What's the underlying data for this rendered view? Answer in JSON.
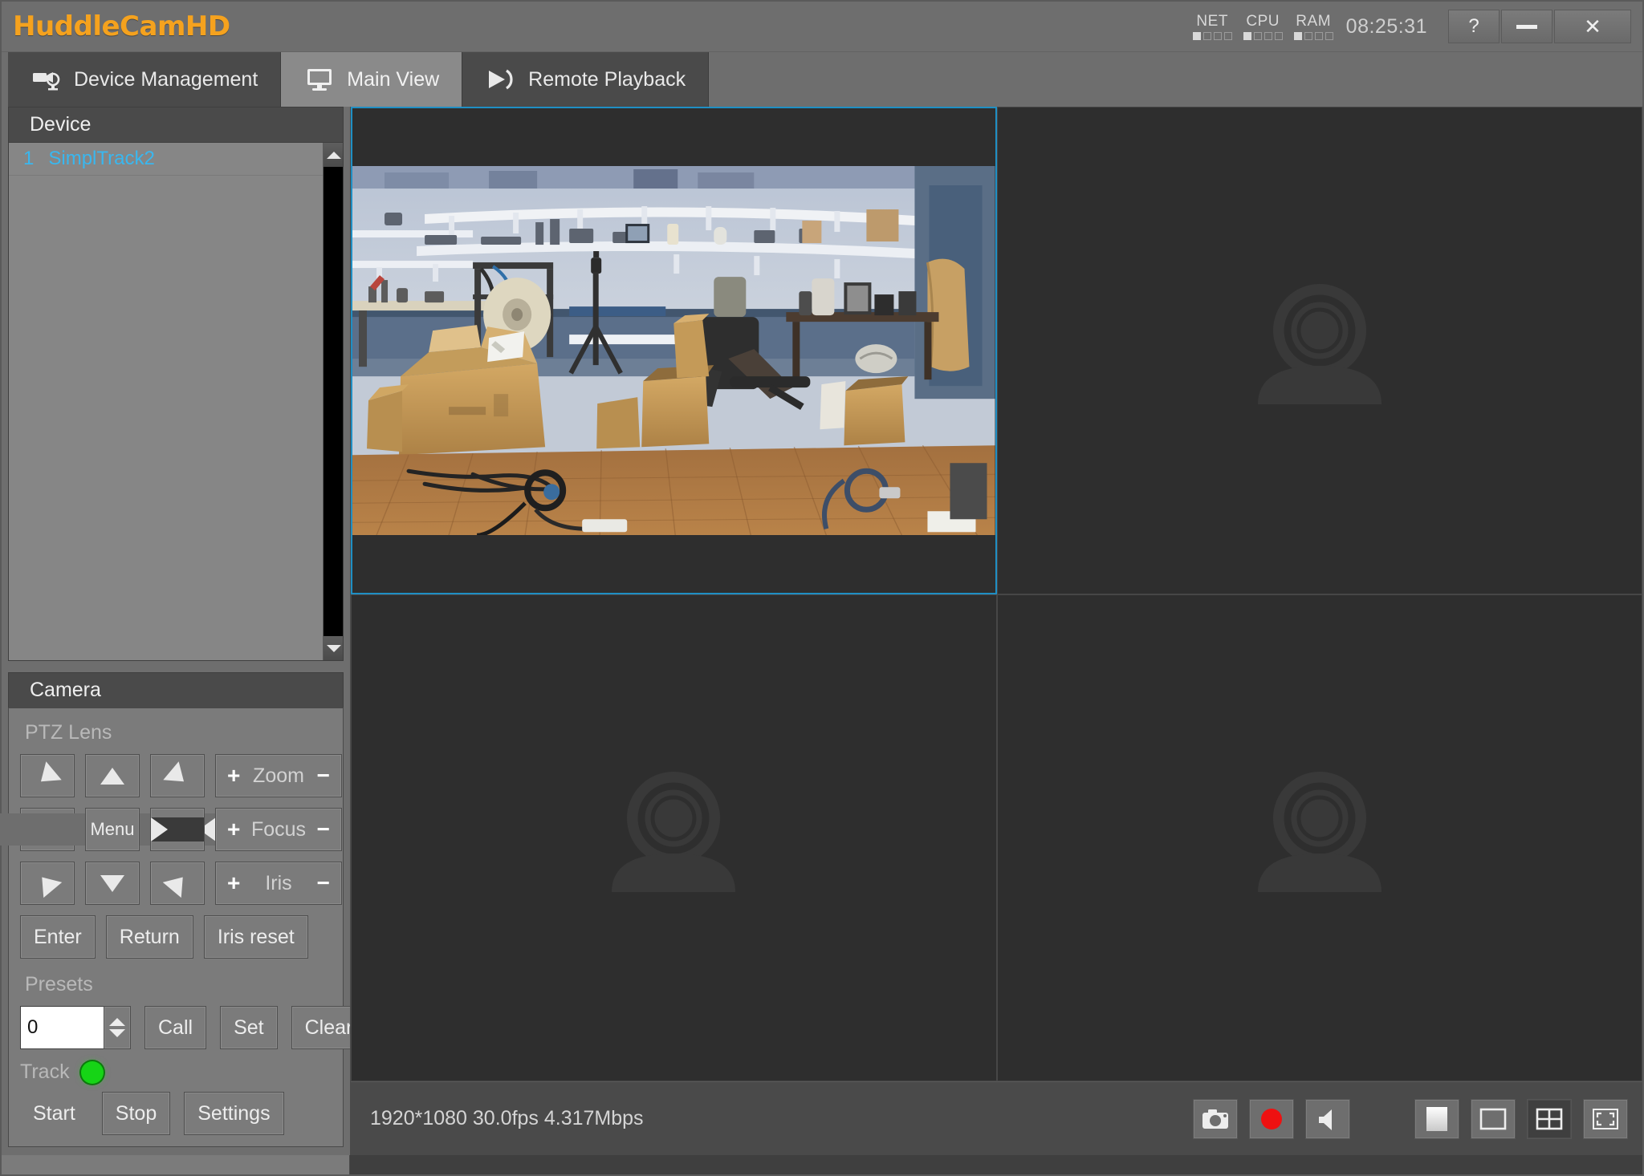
{
  "app": {
    "brand": "HuddleCamHD",
    "clock": "08:25:31"
  },
  "titlebar": {
    "meters": [
      {
        "label": "NET",
        "filled": 1,
        "total": 4
      },
      {
        "label": "CPU",
        "filled": 1,
        "total": 4
      },
      {
        "label": "RAM",
        "filled": 1,
        "total": 4
      }
    ],
    "window_buttons": [
      {
        "name": "help-button",
        "label": "?"
      },
      {
        "name": "minimize-button",
        "label": ""
      },
      {
        "name": "close-button",
        "label": "✕"
      }
    ]
  },
  "tabs": [
    {
      "label": "Device Management",
      "icon": "video-camera-icon",
      "active": false
    },
    {
      "label": "Main View",
      "icon": "monitor-icon",
      "active": true
    },
    {
      "label": "Remote Playback",
      "icon": "play-icon",
      "active": false
    }
  ],
  "device_panel": {
    "title": "Device",
    "rows": [
      {
        "index": "1",
        "name": "SimplTrack2"
      }
    ]
  },
  "camera_panel": {
    "title": "Camera",
    "ptz_label": "PTZ Lens",
    "dpad": [
      {
        "name": "pan-up-left-button",
        "dir": "nw"
      },
      {
        "name": "pan-up-button",
        "dir": "up"
      },
      {
        "name": "pan-up-right-button",
        "dir": "ne"
      },
      {
        "name": "pan-left-button",
        "dir": "left"
      },
      {
        "name": "menu-button",
        "dir": "menu",
        "label": "Menu"
      },
      {
        "name": "pan-right-button",
        "dir": "right"
      },
      {
        "name": "pan-down-left-button",
        "dir": "sw"
      },
      {
        "name": "pan-down-button",
        "dir": "down"
      },
      {
        "name": "pan-down-right-button",
        "dir": "se"
      }
    ],
    "lens": [
      {
        "name": "zoom-control",
        "plus": "+",
        "label": "Zoom",
        "minus": "−"
      },
      {
        "name": "focus-control",
        "plus": "+",
        "label": "Focus",
        "minus": "−"
      },
      {
        "name": "iris-control",
        "plus": "+",
        "label": "Iris",
        "minus": "−"
      }
    ],
    "actions": [
      {
        "name": "enter-button",
        "label": "Enter"
      },
      {
        "name": "return-button",
        "label": "Return"
      },
      {
        "name": "iris-reset-button",
        "label": "Iris reset"
      }
    ],
    "presets": {
      "label": "Presets",
      "value": "0",
      "placeholder": "0",
      "buttons": [
        {
          "name": "call-preset-button",
          "label": "Call"
        },
        {
          "name": "set-preset-button",
          "label": "Set"
        },
        {
          "name": "clear-preset-button",
          "label": "Clear"
        }
      ]
    },
    "track": {
      "label": "Track",
      "led_color": "#16d416",
      "buttons": [
        {
          "name": "track-start-button",
          "label": "Start",
          "flat": true
        },
        {
          "name": "track-stop-button",
          "label": "Stop",
          "flat": false
        },
        {
          "name": "track-settings-button",
          "label": "Settings",
          "flat": false
        }
      ]
    }
  },
  "video_grid": {
    "cells": [
      {
        "name": "video-cell-1",
        "active": true,
        "has_stream": true
      },
      {
        "name": "video-cell-2",
        "active": false,
        "has_stream": false
      },
      {
        "name": "video-cell-3",
        "active": false,
        "has_stream": false
      },
      {
        "name": "video-cell-4",
        "active": false,
        "has_stream": false
      }
    ]
  },
  "bottom_bar": {
    "status": "1920*1080 30.0fps 4.317Mbps",
    "tools": [
      {
        "name": "snapshot-button",
        "icon": "camera-icon"
      },
      {
        "name": "record-button",
        "icon": "record-icon"
      },
      {
        "name": "audio-button",
        "icon": "speaker-icon"
      },
      {
        "name": "stop-all-button",
        "icon": "stop-icon"
      },
      {
        "name": "single-view-button",
        "icon": "single-pane-icon"
      },
      {
        "name": "quad-view-button",
        "icon": "quad-pane-icon",
        "selected": true
      },
      {
        "name": "fullscreen-button",
        "icon": "fullscreen-icon"
      }
    ]
  },
  "colors": {
    "brand": "#F5A21E",
    "accent_selection": "#1f8fc4",
    "device_link": "#39b7ef",
    "record": "#ee1111",
    "led_on": "#16d416"
  }
}
